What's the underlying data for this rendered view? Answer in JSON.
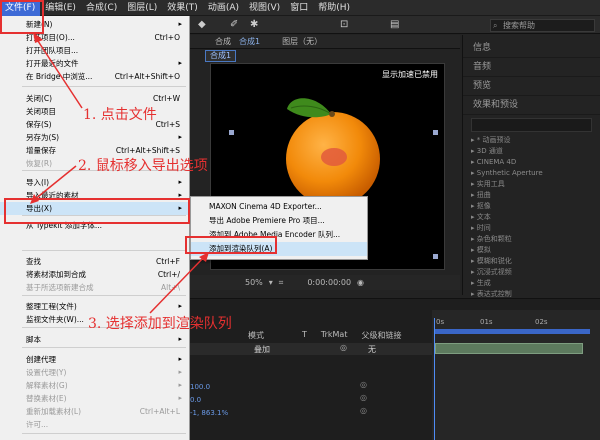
{
  "menubar": {
    "items": [
      "文件(F)",
      "编辑(E)",
      "合成(C)",
      "图层(L)",
      "效果(T)",
      "动画(A)",
      "视图(V)",
      "窗口",
      "帮助(H)"
    ]
  },
  "file_menu": {
    "items": [
      {
        "label": "新建(N)",
        "shortcut": "",
        "submenu": true,
        "disabled": false
      },
      {
        "label": "打开项目(O)...",
        "shortcut": "Ctrl+O",
        "submenu": false,
        "disabled": false
      },
      {
        "label": "打开团队项目...",
        "shortcut": "",
        "submenu": false,
        "disabled": false
      },
      {
        "label": "打开最近的文件",
        "shortcut": "",
        "submenu": true,
        "disabled": false
      },
      {
        "label": "在 Bridge 中浏览...",
        "shortcut": "Ctrl+Alt+Shift+O",
        "submenu": false,
        "disabled": false
      },
      {
        "label": "关闭(C)",
        "shortcut": "Ctrl+W",
        "submenu": false,
        "disabled": false
      },
      {
        "label": "关闭项目",
        "shortcut": "",
        "submenu": false,
        "disabled": false
      },
      {
        "label": "保存(S)",
        "shortcut": "Ctrl+S",
        "submenu": false,
        "disabled": false
      },
      {
        "label": "另存为(S)",
        "shortcut": "",
        "submenu": true,
        "disabled": false
      },
      {
        "label": "增量保存",
        "shortcut": "Ctrl+Alt+Shift+S",
        "submenu": false,
        "disabled": false
      },
      {
        "label": "恢复(R)",
        "shortcut": "",
        "submenu": false,
        "disabled": true
      },
      {
        "label": "导入(I)",
        "shortcut": "",
        "submenu": true,
        "disabled": false
      },
      {
        "label": "导入最近的素材",
        "shortcut": "",
        "submenu": true,
        "disabled": false
      },
      {
        "label": "导出(X)",
        "shortcut": "",
        "submenu": true,
        "disabled": false
      },
      {
        "label": "从 Typekit 添加字体...",
        "shortcut": "",
        "submenu": false,
        "disabled": false
      },
      {
        "label": "查找",
        "shortcut": "Ctrl+F",
        "submenu": false,
        "disabled": false
      },
      {
        "label": "将素材添加到合成",
        "shortcut": "Ctrl+/",
        "submenu": false,
        "disabled": false
      },
      {
        "label": "基于所选项新建合成",
        "shortcut": "Alt+\\",
        "submenu": false,
        "disabled": true
      },
      {
        "label": "整理工程(文件)",
        "shortcut": "",
        "submenu": true,
        "disabled": false
      },
      {
        "label": "监视文件夹(W)...",
        "shortcut": "",
        "submenu": false,
        "disabled": false
      },
      {
        "label": "脚本",
        "shortcut": "",
        "submenu": true,
        "disabled": false
      },
      {
        "label": "创建代理",
        "shortcut": "",
        "submenu": true,
        "disabled": false
      },
      {
        "label": "设置代理(Y)",
        "shortcut": "",
        "submenu": true,
        "disabled": true
      },
      {
        "label": "解释素材(G)",
        "shortcut": "",
        "submenu": true,
        "disabled": true
      },
      {
        "label": "替换素材(E)",
        "shortcut": "",
        "submenu": true,
        "disabled": true
      },
      {
        "label": "重新加载素材(L)",
        "shortcut": "Ctrl+Alt+L",
        "submenu": false,
        "disabled": true
      },
      {
        "label": "许可...",
        "shortcut": "",
        "submenu": false,
        "disabled": true
      }
    ]
  },
  "export_submenu": {
    "items": [
      "MAXON Cinema 4D Exporter...",
      "导出 Adobe Premiere Pro 项目...",
      "添加到 Adobe Media Encoder 队列...",
      "添加到渲染队列(A)"
    ]
  },
  "annotations": {
    "step1": "1. 点击文件",
    "step2": "2. 鼠标移入导出选项",
    "step3": "3. 选择添加到渲染队列"
  },
  "workspace": {
    "search_placeholder": "搜索帮助",
    "panel_tabs": [
      "合成",
      "合成1",
      "图层（无）"
    ],
    "comp_tab": "合成1",
    "gpu_notice": "显示加速已禁用",
    "zoom": "50%",
    "timecode": "0:00:00:00",
    "right_panel": [
      "信息",
      "音频",
      "预览",
      "效果和预设"
    ],
    "effects": [
      "* 动画预设",
      "3D 通道",
      "CINEMA 4D",
      "Synthetic Aperture",
      "实用工具",
      "扭曲",
      "抠像",
      "文本",
      "时间",
      "杂色和颗粒",
      "模拟",
      "模糊和锐化",
      "沉浸式视频",
      "生成",
      "表达式控制",
      "过时"
    ],
    "timeline_headers": [
      "模式",
      "T",
      "TrkMat",
      "父级和链接"
    ],
    "layer_mode": "叠加",
    "layer_parent": "无",
    "ruler_marks": [
      "0s",
      "01s",
      "02s"
    ],
    "values": [
      "100.0",
      "0.0",
      "-1, 863.1%"
    ]
  },
  "colors": {
    "menubar_active": "#3d6ad6",
    "annotation": "#e53030",
    "menu_highlight": "#cce4f7"
  }
}
